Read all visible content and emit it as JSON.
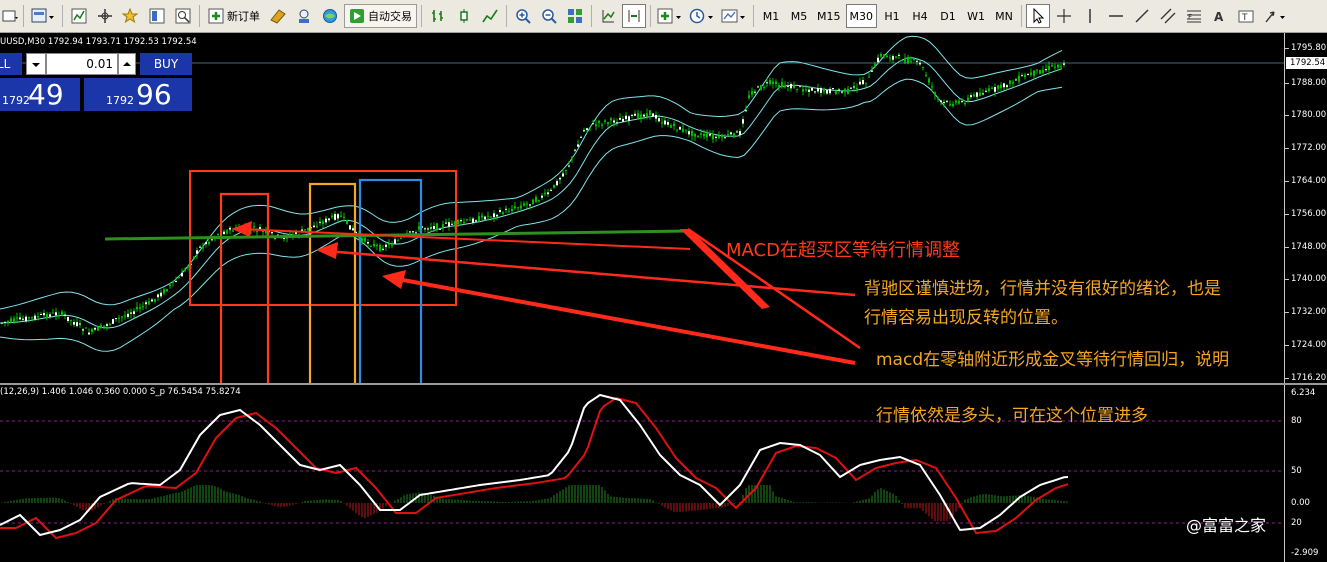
{
  "toolbar": {
    "new_order_label": "新订单",
    "auto_trading_label": "自动交易",
    "timeframes": [
      "M1",
      "M5",
      "M15",
      "M30",
      "H1",
      "H4",
      "D1",
      "W1",
      "MN"
    ],
    "active_timeframe": "M30"
  },
  "chart": {
    "info_line": "UUSD,M30  1792.94 1793.71 1792.53 1792.54",
    "price_axis_labels": [
      "1795.80",
      "1788.00",
      "1780.00",
      "1772.00",
      "1764.00",
      "1756.00",
      "1748.00",
      "1740.00",
      "1732.00",
      "1724.00",
      "1716.20"
    ],
    "current_price": "1792.54"
  },
  "trading_panel": {
    "sell_label": "LL",
    "buy_label": "BUY",
    "lot_value": "0.01",
    "sell_price_small": "1792",
    "sell_price_big": "49",
    "buy_price_small": "1792",
    "buy_price_big": "96"
  },
  "subwindow": {
    "info_line": "(12,26,9) 1.406 1.046 0.360 0.000   S_p 76.5454 75.8274",
    "axis_labels": [
      "6.234",
      "80",
      "50",
      "0.00",
      "20",
      "-2.909"
    ]
  },
  "annotations": {
    "macd_overbought": "MACD在超买区等待行情调整",
    "divergence_line1": "背驰区谨慎进场，行情并没有很好的绪论，也是",
    "divergence_line2": "行情容易出现反转的位置。",
    "golden_cross_line1": "macd在零轴附近形成金叉等待行情回归，说明",
    "golden_cross_line2": "行情依然是多头，可在这个位置进多"
  },
  "watermark": "@富富之家",
  "colors": {
    "background": "#000000",
    "bull_candle": "#00c000",
    "bollinger": "#7fe4ec",
    "macd_main": "#ffffff",
    "macd_signal": "#e01010",
    "annotation_red": "#ff3b1a",
    "annotation_orange": "#f5a623",
    "box_yellow": "#f5a623",
    "box_blue": "#2e8de0",
    "trend_line": "#2f8f1f"
  },
  "chart_data": {
    "type": "candlestick",
    "symbol": "UUSD",
    "timeframe": "M30",
    "ohlc_last": {
      "open": 1792.94,
      "high": 1793.71,
      "low": 1792.53,
      "close": 1792.54
    },
    "ylim": [
      1716.2,
      1799.0
    ]
  }
}
